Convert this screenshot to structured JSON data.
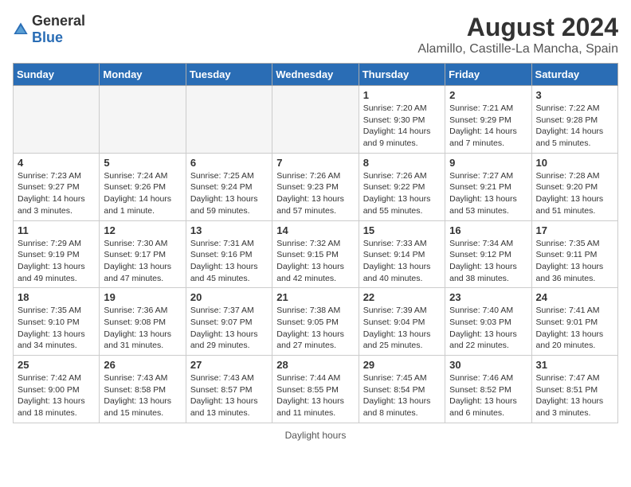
{
  "header": {
    "logo_general": "General",
    "logo_blue": "Blue",
    "title": "August 2024",
    "subtitle": "Alamillo, Castille-La Mancha, Spain"
  },
  "weekdays": [
    "Sunday",
    "Monday",
    "Tuesday",
    "Wednesday",
    "Thursday",
    "Friday",
    "Saturday"
  ],
  "footer": "Daylight hours",
  "weeks": [
    [
      {
        "day": "",
        "empty": true
      },
      {
        "day": "",
        "empty": true
      },
      {
        "day": "",
        "empty": true
      },
      {
        "day": "",
        "empty": true
      },
      {
        "day": "1",
        "sunrise": "Sunrise: 7:20 AM",
        "sunset": "Sunset: 9:30 PM",
        "daylight": "Daylight: 14 hours and 9 minutes."
      },
      {
        "day": "2",
        "sunrise": "Sunrise: 7:21 AM",
        "sunset": "Sunset: 9:29 PM",
        "daylight": "Daylight: 14 hours and 7 minutes."
      },
      {
        "day": "3",
        "sunrise": "Sunrise: 7:22 AM",
        "sunset": "Sunset: 9:28 PM",
        "daylight": "Daylight: 14 hours and 5 minutes."
      }
    ],
    [
      {
        "day": "4",
        "sunrise": "Sunrise: 7:23 AM",
        "sunset": "Sunset: 9:27 PM",
        "daylight": "Daylight: 14 hours and 3 minutes."
      },
      {
        "day": "5",
        "sunrise": "Sunrise: 7:24 AM",
        "sunset": "Sunset: 9:26 PM",
        "daylight": "Daylight: 14 hours and 1 minute."
      },
      {
        "day": "6",
        "sunrise": "Sunrise: 7:25 AM",
        "sunset": "Sunset: 9:24 PM",
        "daylight": "Daylight: 13 hours and 59 minutes."
      },
      {
        "day": "7",
        "sunrise": "Sunrise: 7:26 AM",
        "sunset": "Sunset: 9:23 PM",
        "daylight": "Daylight: 13 hours and 57 minutes."
      },
      {
        "day": "8",
        "sunrise": "Sunrise: 7:26 AM",
        "sunset": "Sunset: 9:22 PM",
        "daylight": "Daylight: 13 hours and 55 minutes."
      },
      {
        "day": "9",
        "sunrise": "Sunrise: 7:27 AM",
        "sunset": "Sunset: 9:21 PM",
        "daylight": "Daylight: 13 hours and 53 minutes."
      },
      {
        "day": "10",
        "sunrise": "Sunrise: 7:28 AM",
        "sunset": "Sunset: 9:20 PM",
        "daylight": "Daylight: 13 hours and 51 minutes."
      }
    ],
    [
      {
        "day": "11",
        "sunrise": "Sunrise: 7:29 AM",
        "sunset": "Sunset: 9:19 PM",
        "daylight": "Daylight: 13 hours and 49 minutes."
      },
      {
        "day": "12",
        "sunrise": "Sunrise: 7:30 AM",
        "sunset": "Sunset: 9:17 PM",
        "daylight": "Daylight: 13 hours and 47 minutes."
      },
      {
        "day": "13",
        "sunrise": "Sunrise: 7:31 AM",
        "sunset": "Sunset: 9:16 PM",
        "daylight": "Daylight: 13 hours and 45 minutes."
      },
      {
        "day": "14",
        "sunrise": "Sunrise: 7:32 AM",
        "sunset": "Sunset: 9:15 PM",
        "daylight": "Daylight: 13 hours and 42 minutes."
      },
      {
        "day": "15",
        "sunrise": "Sunrise: 7:33 AM",
        "sunset": "Sunset: 9:14 PM",
        "daylight": "Daylight: 13 hours and 40 minutes."
      },
      {
        "day": "16",
        "sunrise": "Sunrise: 7:34 AM",
        "sunset": "Sunset: 9:12 PM",
        "daylight": "Daylight: 13 hours and 38 minutes."
      },
      {
        "day": "17",
        "sunrise": "Sunrise: 7:35 AM",
        "sunset": "Sunset: 9:11 PM",
        "daylight": "Daylight: 13 hours and 36 minutes."
      }
    ],
    [
      {
        "day": "18",
        "sunrise": "Sunrise: 7:35 AM",
        "sunset": "Sunset: 9:10 PM",
        "daylight": "Daylight: 13 hours and 34 minutes."
      },
      {
        "day": "19",
        "sunrise": "Sunrise: 7:36 AM",
        "sunset": "Sunset: 9:08 PM",
        "daylight": "Daylight: 13 hours and 31 minutes."
      },
      {
        "day": "20",
        "sunrise": "Sunrise: 7:37 AM",
        "sunset": "Sunset: 9:07 PM",
        "daylight": "Daylight: 13 hours and 29 minutes."
      },
      {
        "day": "21",
        "sunrise": "Sunrise: 7:38 AM",
        "sunset": "Sunset: 9:05 PM",
        "daylight": "Daylight: 13 hours and 27 minutes."
      },
      {
        "day": "22",
        "sunrise": "Sunrise: 7:39 AM",
        "sunset": "Sunset: 9:04 PM",
        "daylight": "Daylight: 13 hours and 25 minutes."
      },
      {
        "day": "23",
        "sunrise": "Sunrise: 7:40 AM",
        "sunset": "Sunset: 9:03 PM",
        "daylight": "Daylight: 13 hours and 22 minutes."
      },
      {
        "day": "24",
        "sunrise": "Sunrise: 7:41 AM",
        "sunset": "Sunset: 9:01 PM",
        "daylight": "Daylight: 13 hours and 20 minutes."
      }
    ],
    [
      {
        "day": "25",
        "sunrise": "Sunrise: 7:42 AM",
        "sunset": "Sunset: 9:00 PM",
        "daylight": "Daylight: 13 hours and 18 minutes."
      },
      {
        "day": "26",
        "sunrise": "Sunrise: 7:43 AM",
        "sunset": "Sunset: 8:58 PM",
        "daylight": "Daylight: 13 hours and 15 minutes."
      },
      {
        "day": "27",
        "sunrise": "Sunrise: 7:43 AM",
        "sunset": "Sunset: 8:57 PM",
        "daylight": "Daylight: 13 hours and 13 minutes."
      },
      {
        "day": "28",
        "sunrise": "Sunrise: 7:44 AM",
        "sunset": "Sunset: 8:55 PM",
        "daylight": "Daylight: 13 hours and 11 minutes."
      },
      {
        "day": "29",
        "sunrise": "Sunrise: 7:45 AM",
        "sunset": "Sunset: 8:54 PM",
        "daylight": "Daylight: 13 hours and 8 minutes."
      },
      {
        "day": "30",
        "sunrise": "Sunrise: 7:46 AM",
        "sunset": "Sunset: 8:52 PM",
        "daylight": "Daylight: 13 hours and 6 minutes."
      },
      {
        "day": "31",
        "sunrise": "Sunrise: 7:47 AM",
        "sunset": "Sunset: 8:51 PM",
        "daylight": "Daylight: 13 hours and 3 minutes."
      }
    ]
  ]
}
